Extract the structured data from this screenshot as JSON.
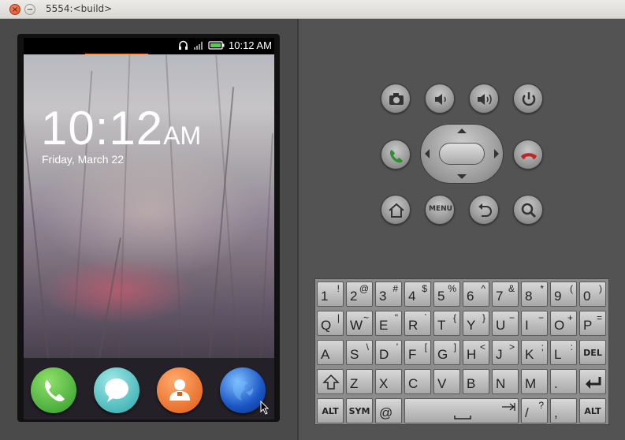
{
  "window": {
    "title": "5554:<build>",
    "close_symbol": "×",
    "minimize_symbol": "−"
  },
  "phone": {
    "status": {
      "time": "10:12 AM",
      "headphones_icon": "headphones-icon",
      "signal_icon": "signal-icon",
      "battery_icon": "battery-icon"
    },
    "lockscreen": {
      "clock_time": "10:12",
      "clock_ampm": "AM",
      "date": "Friday, March 22"
    },
    "dock_apps": [
      {
        "name": "Phone",
        "icon": "phone-app-icon"
      },
      {
        "name": "Messages",
        "icon": "messages-app-icon"
      },
      {
        "name": "Contacts",
        "icon": "contacts-app-icon"
      },
      {
        "name": "Browser",
        "icon": "browser-app-icon"
      }
    ]
  },
  "controls": {
    "camera": "camera-icon",
    "volume_down": "volume-down-icon",
    "volume_up": "volume-up-icon",
    "power": "power-icon",
    "call": "call-icon",
    "end_call": "end-call-icon",
    "home": "home-icon",
    "menu_label": "MENU",
    "back": "back-icon",
    "search": "search-icon"
  },
  "keyboard": {
    "row1": [
      [
        "1",
        "!"
      ],
      [
        "2",
        "@"
      ],
      [
        "3",
        "#"
      ],
      [
        "4",
        "$"
      ],
      [
        "5",
        "%"
      ],
      [
        "6",
        "^"
      ],
      [
        "7",
        "&"
      ],
      [
        "8",
        "*"
      ],
      [
        "9",
        "("
      ],
      [
        "0",
        ")"
      ]
    ],
    "row2": [
      [
        "Q",
        "|"
      ],
      [
        "W",
        "~"
      ],
      [
        "E",
        "\""
      ],
      [
        "R",
        "`"
      ],
      [
        "T",
        "{"
      ],
      [
        "Y",
        "}"
      ],
      [
        "U",
        "−"
      ],
      [
        "I",
        "−"
      ],
      [
        "O",
        "+"
      ],
      [
        "P",
        "="
      ]
    ],
    "row3": [
      [
        "A",
        ""
      ],
      [
        "S",
        "\\"
      ],
      [
        "D",
        "'"
      ],
      [
        "F",
        "["
      ],
      [
        "G",
        "]"
      ],
      [
        "H",
        "<"
      ],
      [
        "J",
        ">"
      ],
      [
        "K",
        ";"
      ],
      [
        "L",
        ":"
      ]
    ],
    "row3_del": "DEL",
    "row4": [
      [
        "Z",
        ""
      ],
      [
        "X",
        ""
      ],
      [
        "C",
        ""
      ],
      [
        "V",
        ""
      ],
      [
        "B",
        ""
      ],
      [
        "N",
        ""
      ],
      [
        "M",
        ""
      ],
      [
        ".",
        ""
      ]
    ],
    "row5": {
      "alt_left": "ALT",
      "sym": "SYM",
      "at": "@",
      "slash": "/",
      "question": "?",
      "comma": ",",
      "alt_right": "ALT"
    }
  }
}
